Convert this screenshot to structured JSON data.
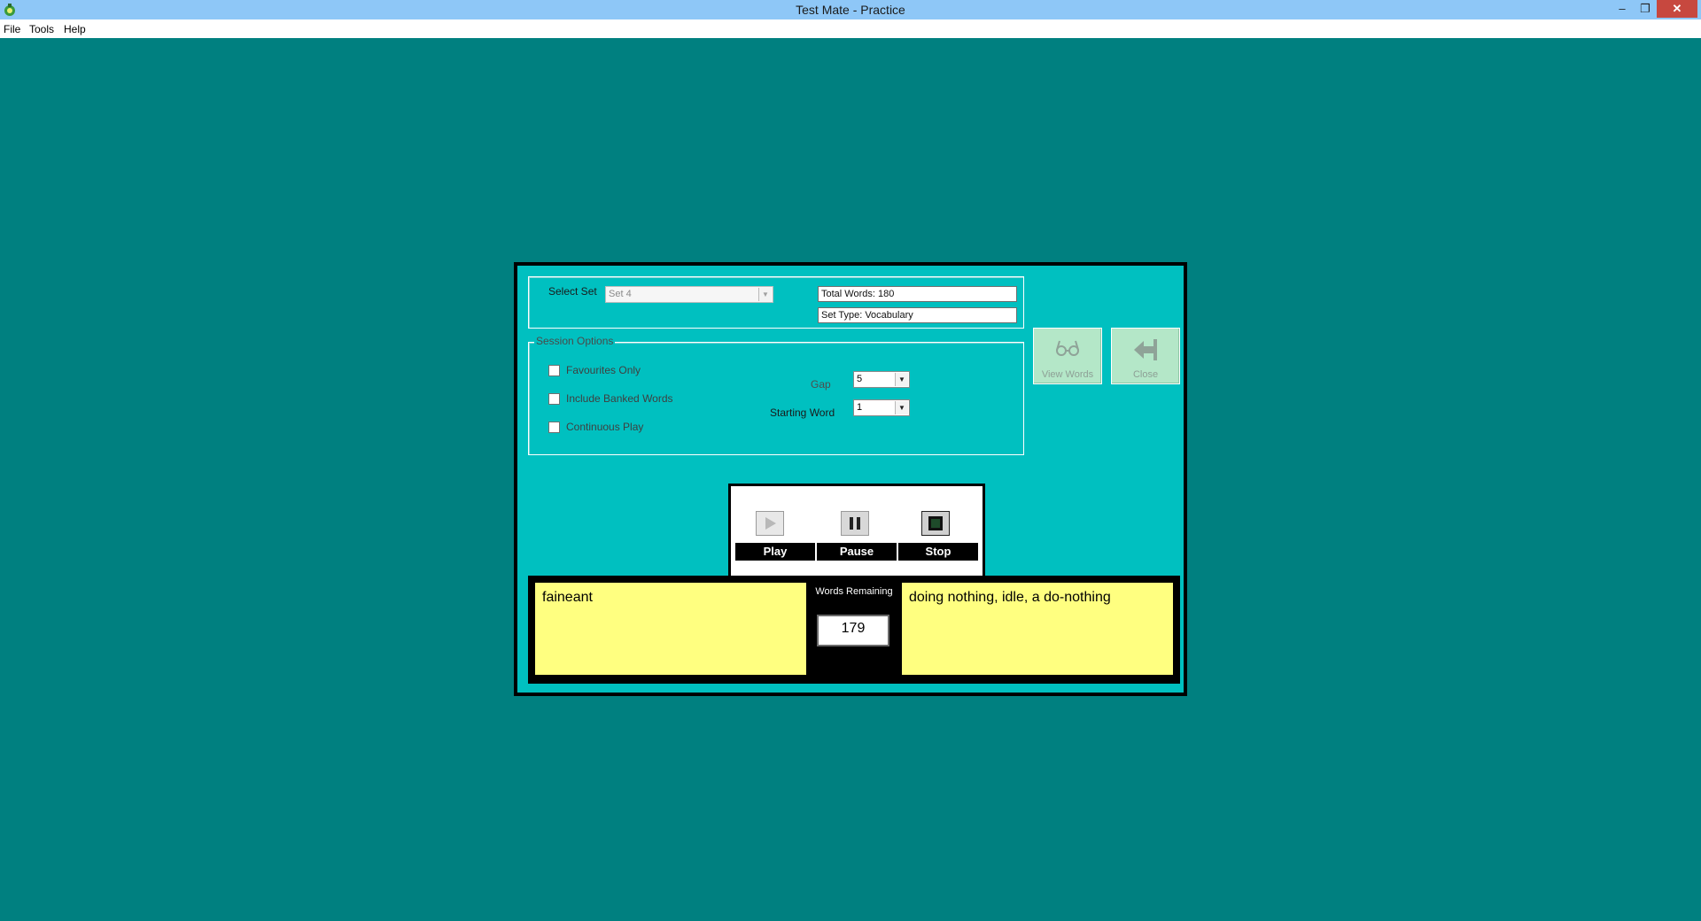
{
  "window": {
    "title": "Test Mate - Practice",
    "controls": {
      "minimize": "–",
      "restore": "❐",
      "close": "✕"
    }
  },
  "menu": [
    {
      "label": "File"
    },
    {
      "label": "Tools"
    },
    {
      "label": "Help"
    }
  ],
  "set_panel": {
    "select_label": "Select Set",
    "select_value": "Set 4",
    "total_words": "Total Words: 180",
    "set_type": "Set Type: Vocabulary"
  },
  "session_options": {
    "legend": "Session Options",
    "favourites_only": {
      "label": "Favourites Only",
      "checked": false
    },
    "include_banked": {
      "label": "Include Banked Words",
      "checked": false
    },
    "continuous_play": {
      "label": "Continuous Play",
      "checked": false
    },
    "gap_label": "Gap",
    "gap_value": "5",
    "starting_word_label": "Starting Word",
    "starting_word_value": "1"
  },
  "side_buttons": {
    "view_words": "View Words",
    "close": "Close"
  },
  "media": {
    "play": "Play",
    "pause": "Pause",
    "stop": "Stop"
  },
  "word": {
    "term": "faineant",
    "definition": "doing nothing, idle, a do-nothing",
    "remaining_label": "Words Remaining",
    "remaining_value": "179"
  },
  "colors": {
    "desktop": "#008080",
    "dialog": "#00c0c0",
    "card": "#ffff80",
    "titlebar": "#8ec7f7",
    "close": "#c7483f"
  }
}
